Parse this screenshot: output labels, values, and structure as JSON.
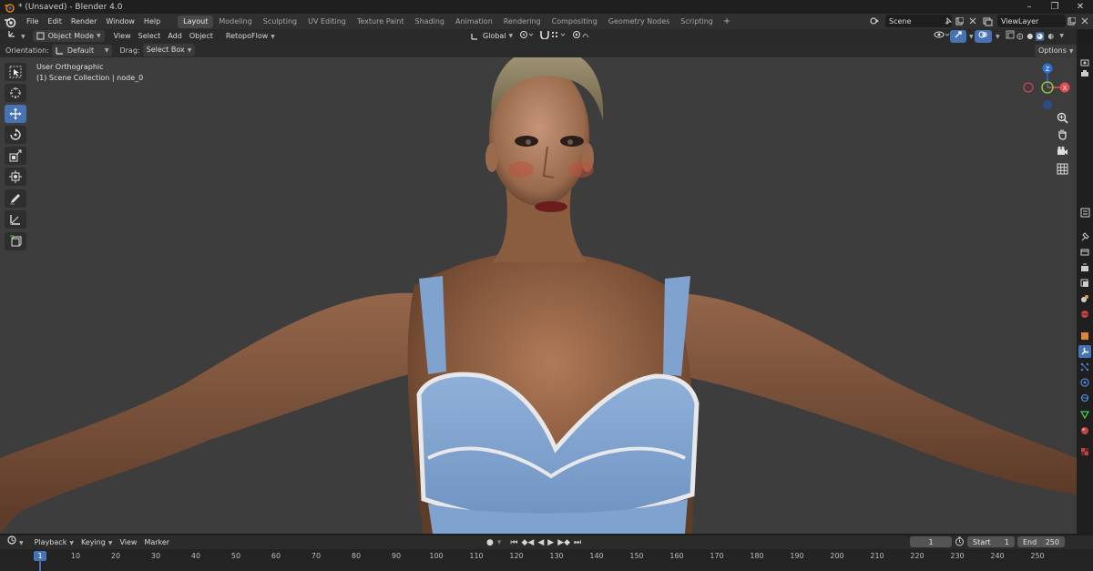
{
  "window": {
    "title": "* (Unsaved) - Blender 4.0",
    "minimize": "–",
    "maximize": "❐",
    "close": "✕"
  },
  "menus": [
    "File",
    "Edit",
    "Render",
    "Window",
    "Help"
  ],
  "workspaces": [
    {
      "label": "Layout",
      "active": true
    },
    {
      "label": "Modeling",
      "active": false
    },
    {
      "label": "Sculpting",
      "active": false
    },
    {
      "label": "UV Editing",
      "active": false
    },
    {
      "label": "Texture Paint",
      "active": false
    },
    {
      "label": "Shading",
      "active": false
    },
    {
      "label": "Animation",
      "active": false
    },
    {
      "label": "Rendering",
      "active": false
    },
    {
      "label": "Compositing",
      "active": false
    },
    {
      "label": "Geometry Nodes",
      "active": false
    },
    {
      "label": "Scripting",
      "active": false
    }
  ],
  "workspace_add": "+",
  "scene": {
    "name": "Scene"
  },
  "view_layer": {
    "name": "ViewLayer"
  },
  "viewport_header": {
    "mode": "Object Mode",
    "menus": [
      "View",
      "Select",
      "Add",
      "Object"
    ],
    "addon": "RetopoFlow",
    "transform_orientation": "Global"
  },
  "tool_settings": {
    "orientation_label": "Orientation:",
    "orientation_value": "Default",
    "drag_label": "Drag:",
    "drag_value": "Select Box",
    "options": "Options"
  },
  "viewport_info": {
    "view_name": "User Orthographic",
    "collection": "(1) Scene Collection | node_0"
  },
  "gizmo": {
    "z_label": "Z",
    "x_label": "X",
    "colors": {
      "x": "#e34b52",
      "y": "#8bc43b",
      "z": "#2e6fd6",
      "neg": "#7b2b33"
    }
  },
  "timeline": {
    "menus": [
      "Playback",
      "Keying",
      "View",
      "Marker"
    ],
    "current_frame": "1",
    "start_label": "Start",
    "start_value": "1",
    "end_label": "End",
    "end_value": "250",
    "ticks": [
      "1",
      "10",
      "20",
      "30",
      "40",
      "50",
      "60",
      "70",
      "80",
      "90",
      "100",
      "110",
      "120",
      "130",
      "140",
      "150",
      "160",
      "170",
      "180",
      "190",
      "200",
      "210",
      "220",
      "230",
      "240",
      "250"
    ]
  },
  "colors": {
    "accent": "#4772b3"
  }
}
